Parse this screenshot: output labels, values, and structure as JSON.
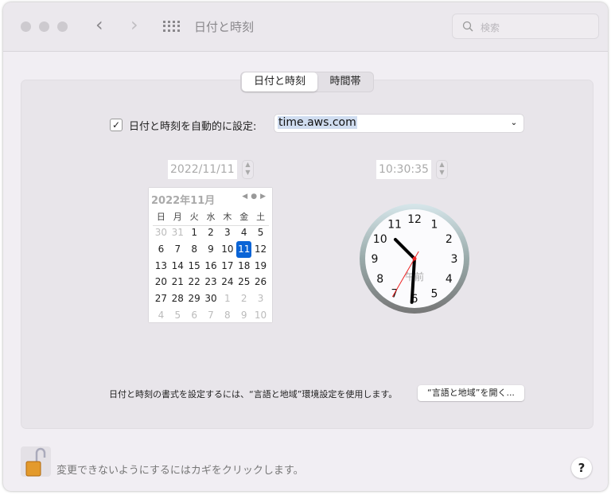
{
  "window": {
    "title": "日付と時刻",
    "search_placeholder": "検索"
  },
  "tabs": [
    {
      "label": "日付と時刻",
      "selected": true
    },
    {
      "label": "時間帯",
      "selected": false
    }
  ],
  "auto": {
    "label": "日付と時刻を自動的に設定:",
    "checked": true,
    "server": "time.aws.com"
  },
  "date_field": "2022/11/11",
  "time_field": "10:30:35",
  "calendar": {
    "header": "2022年11月",
    "weekdays": [
      "日",
      "月",
      "火",
      "水",
      "木",
      "金",
      "土"
    ],
    "days": [
      [
        "30",
        "o"
      ],
      [
        "31",
        "o"
      ],
      [
        "1",
        ""
      ],
      [
        "2",
        ""
      ],
      [
        "3",
        ""
      ],
      [
        "4",
        ""
      ],
      [
        "5",
        ""
      ],
      [
        "6",
        ""
      ],
      [
        "7",
        ""
      ],
      [
        "8",
        ""
      ],
      [
        "9",
        ""
      ],
      [
        "10",
        ""
      ],
      [
        "11",
        "sel"
      ],
      [
        "12",
        ""
      ],
      [
        "13",
        ""
      ],
      [
        "14",
        ""
      ],
      [
        "15",
        ""
      ],
      [
        "16",
        ""
      ],
      [
        "17",
        ""
      ],
      [
        "18",
        ""
      ],
      [
        "19",
        ""
      ],
      [
        "20",
        ""
      ],
      [
        "21",
        ""
      ],
      [
        "22",
        ""
      ],
      [
        "23",
        ""
      ],
      [
        "24",
        ""
      ],
      [
        "25",
        ""
      ],
      [
        "26",
        ""
      ],
      [
        "27",
        ""
      ],
      [
        "28",
        ""
      ],
      [
        "29",
        ""
      ],
      [
        "30",
        ""
      ],
      [
        "1",
        "o"
      ],
      [
        "2",
        "o"
      ],
      [
        "3",
        "o"
      ],
      [
        "4",
        "o"
      ],
      [
        "5",
        "o"
      ],
      [
        "6",
        "o"
      ],
      [
        "7",
        "o"
      ],
      [
        "8",
        "o"
      ],
      [
        "9",
        "o"
      ],
      [
        "10",
        "o"
      ]
    ]
  },
  "clock": {
    "hours": 10,
    "minutes": 30,
    "seconds": 35,
    "ampm": "午前",
    "numbers": [
      "12",
      "1",
      "2",
      "3",
      "4",
      "5",
      "6",
      "7",
      "8",
      "9",
      "10",
      "11"
    ]
  },
  "format_note": "日付と時刻の書式を設定するには、“言語と地域”環境設定を使用します。",
  "open_button": "“言語と地域”を開く...",
  "lock_text": "変更できないようにするにはカギをクリックします。",
  "help": "?"
}
